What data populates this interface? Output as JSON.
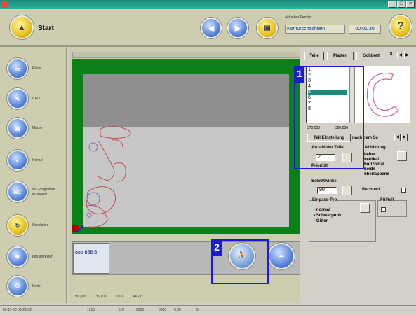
{
  "window": {
    "controls": [
      "_",
      "□",
      "×"
    ]
  },
  "toolbar": {
    "start_label": "Start",
    "current_window_caption": "Aktuelles Fenster",
    "current_window_value": "Konturschachteln",
    "time": "00:01:30",
    "help_glyph": "?"
  },
  "sidebar": {
    "items": [
      {
        "label": "Platte",
        "icon": "plate-icon"
      },
      {
        "label": "CAD",
        "icon": "cad-icon"
      },
      {
        "label": "Macro",
        "icon": "macro-icon"
      },
      {
        "label": "Kontur",
        "icon": "contour-icon"
      },
      {
        "label": "NC-Programm erzeugen",
        "icon": "nc-program-icon"
      },
      {
        "label": "Simulation",
        "icon": "simulation-icon"
      },
      {
        "label": "Info anzeigen",
        "icon": "info-icon"
      },
      {
        "label": "Ende",
        "icon": "exit-icon"
      }
    ]
  },
  "canvas": {
    "status_left": "900,00",
    "status_mid": "350,00",
    "status_right1": "0,00",
    "status_right2": "44,22"
  },
  "nestbar": {
    "thumb_text": "ooo ƃƃƃ ƃ"
  },
  "right_panel": {
    "tabs": [
      "Teile",
      "Platten",
      "Schbrett"
    ],
    "parts_list": [
      "1",
      "2",
      "3",
      "4",
      "5",
      "6",
      "7",
      "8"
    ],
    "selected_index": 4,
    "dims_left": "370,000",
    "dims_right": "380,000",
    "subtabs": [
      "Teil Einstellung",
      "nach dem Sc"
    ],
    "count_label": "Anzahl der Teile",
    "count_value": "2",
    "priority_label": "Priorität",
    "rotation_label": "Abbildung",
    "rotation_options": [
      "keine",
      "vertikal",
      "horizontal",
      "beide",
      "überlappend"
    ],
    "step_label": "Schrittwinkel",
    "step_value": "90",
    "rectangle_label": "Rechteck",
    "fit_group": "Einpass-Typ",
    "fit_options": [
      "normal",
      "Schwerpunkt",
      "Gitter"
    ],
    "fit_selected": 1,
    "filling_label": "Füllteil"
  },
  "statusbar": {
    "date": "09-11-00 09-29-02",
    "v1": "1215",
    "v2": "5,0",
    "v3": "3000",
    "v4": "3000",
    "v5": "0,00",
    "v6": "0"
  },
  "markers": {
    "m1": "1",
    "m2": "2"
  },
  "colors": {
    "canvas_border": "#0b7f18",
    "marker": "#1b1bd6",
    "titlebar": "#1c8a7a"
  }
}
